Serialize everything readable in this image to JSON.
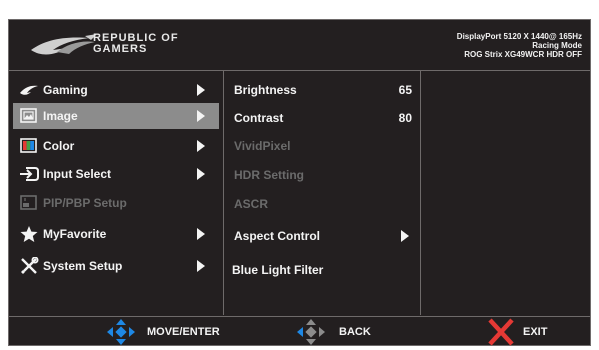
{
  "header": {
    "brand_line1": "REPUBLIC OF",
    "brand_line2": "GAMERS",
    "status_line1": "DisplayPort 5120 X 1440@ 165Hz",
    "status_line2": "Racing Mode",
    "status_line3": "ROG Strix XG49WCR HDR OFF"
  },
  "main_menu": {
    "items": [
      {
        "label": "Gaming",
        "icon": "rog-eye-icon",
        "enabled": true,
        "selected": false
      },
      {
        "label": "Image",
        "icon": "image-icon",
        "enabled": true,
        "selected": true
      },
      {
        "label": "Color",
        "icon": "color-palette-icon",
        "enabled": true,
        "selected": false
      },
      {
        "label": "Input Select",
        "icon": "input-select-icon",
        "enabled": true,
        "selected": false
      },
      {
        "label": "PIP/PBP Setup",
        "icon": "pip-pbp-icon",
        "enabled": false,
        "selected": false
      },
      {
        "label": "MyFavorite",
        "icon": "star-icon",
        "enabled": true,
        "selected": false
      },
      {
        "label": "System Setup",
        "icon": "wrench-screwdriver-icon",
        "enabled": true,
        "selected": false
      }
    ]
  },
  "submenu": {
    "items": [
      {
        "label": "Brightness",
        "value": "65",
        "enabled": true
      },
      {
        "label": "Contrast",
        "value": "80",
        "enabled": true
      },
      {
        "label": "VividPixel",
        "value": "",
        "enabled": false
      },
      {
        "label": "HDR Setting",
        "value": "",
        "enabled": false
      },
      {
        "label": "ASCR",
        "value": "",
        "enabled": false
      },
      {
        "label": "Aspect Control",
        "value": "",
        "enabled": true
      },
      {
        "label": "Blue Light Filter",
        "value": "",
        "enabled": true
      }
    ]
  },
  "footer": {
    "move_label": "MOVE/ENTER",
    "back_label": "BACK",
    "exit_label": "EXIT"
  },
  "colors": {
    "background": "#231f20",
    "selected": "#8c8c8c",
    "dpad_blue": "#1e88e5",
    "exit_red": "#e53935",
    "disabled_text": "#6b6b6b"
  }
}
